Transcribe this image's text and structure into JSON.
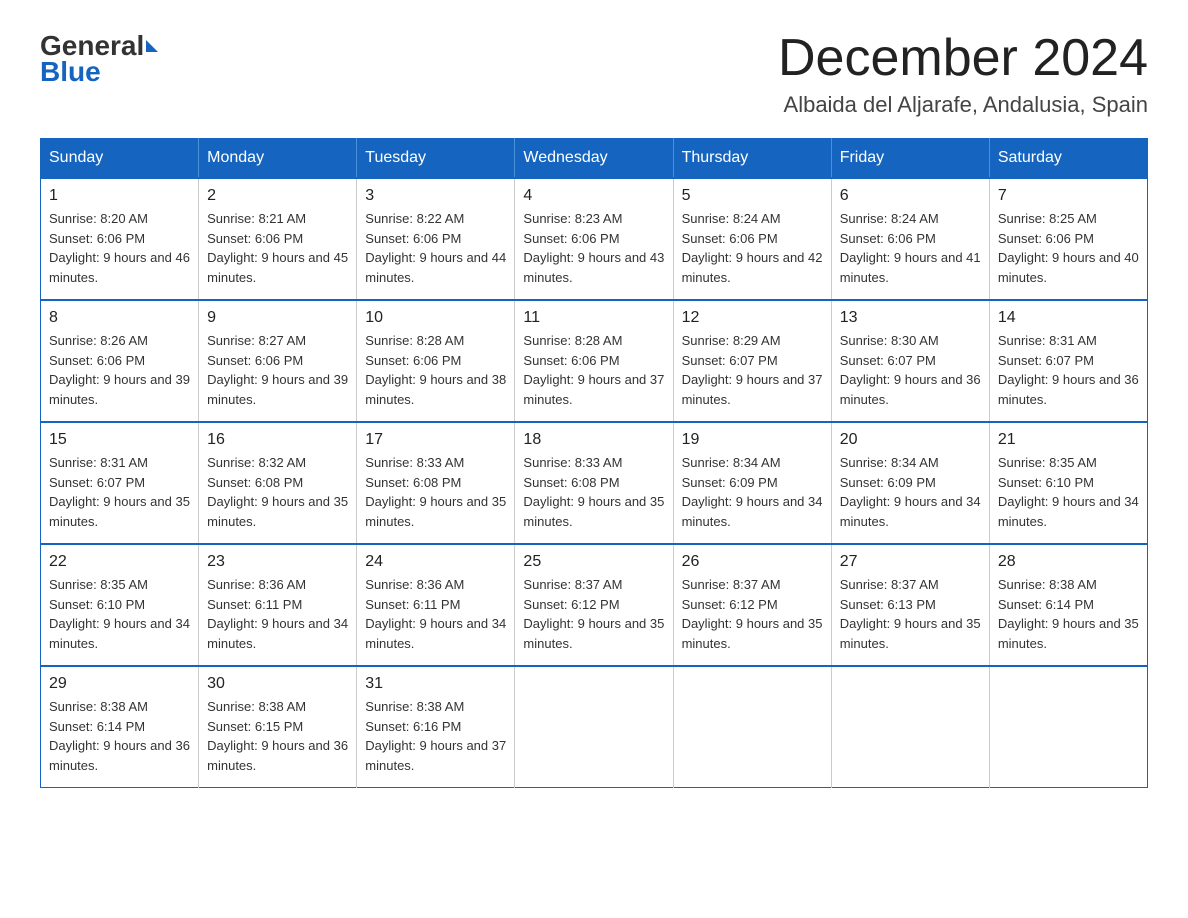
{
  "header": {
    "logo_general": "General",
    "logo_blue": "Blue",
    "month_title": "December 2024",
    "location": "Albaida del Aljarafe, Andalusia, Spain"
  },
  "weekdays": [
    "Sunday",
    "Monday",
    "Tuesday",
    "Wednesday",
    "Thursday",
    "Friday",
    "Saturday"
  ],
  "weeks": [
    [
      {
        "day": "1",
        "sunrise": "8:20 AM",
        "sunset": "6:06 PM",
        "daylight": "9 hours and 46 minutes."
      },
      {
        "day": "2",
        "sunrise": "8:21 AM",
        "sunset": "6:06 PM",
        "daylight": "9 hours and 45 minutes."
      },
      {
        "day": "3",
        "sunrise": "8:22 AM",
        "sunset": "6:06 PM",
        "daylight": "9 hours and 44 minutes."
      },
      {
        "day": "4",
        "sunrise": "8:23 AM",
        "sunset": "6:06 PM",
        "daylight": "9 hours and 43 minutes."
      },
      {
        "day": "5",
        "sunrise": "8:24 AM",
        "sunset": "6:06 PM",
        "daylight": "9 hours and 42 minutes."
      },
      {
        "day": "6",
        "sunrise": "8:24 AM",
        "sunset": "6:06 PM",
        "daylight": "9 hours and 41 minutes."
      },
      {
        "day": "7",
        "sunrise": "8:25 AM",
        "sunset": "6:06 PM",
        "daylight": "9 hours and 40 minutes."
      }
    ],
    [
      {
        "day": "8",
        "sunrise": "8:26 AM",
        "sunset": "6:06 PM",
        "daylight": "9 hours and 39 minutes."
      },
      {
        "day": "9",
        "sunrise": "8:27 AM",
        "sunset": "6:06 PM",
        "daylight": "9 hours and 39 minutes."
      },
      {
        "day": "10",
        "sunrise": "8:28 AM",
        "sunset": "6:06 PM",
        "daylight": "9 hours and 38 minutes."
      },
      {
        "day": "11",
        "sunrise": "8:28 AM",
        "sunset": "6:06 PM",
        "daylight": "9 hours and 37 minutes."
      },
      {
        "day": "12",
        "sunrise": "8:29 AM",
        "sunset": "6:07 PM",
        "daylight": "9 hours and 37 minutes."
      },
      {
        "day": "13",
        "sunrise": "8:30 AM",
        "sunset": "6:07 PM",
        "daylight": "9 hours and 36 minutes."
      },
      {
        "day": "14",
        "sunrise": "8:31 AM",
        "sunset": "6:07 PM",
        "daylight": "9 hours and 36 minutes."
      }
    ],
    [
      {
        "day": "15",
        "sunrise": "8:31 AM",
        "sunset": "6:07 PM",
        "daylight": "9 hours and 35 minutes."
      },
      {
        "day": "16",
        "sunrise": "8:32 AM",
        "sunset": "6:08 PM",
        "daylight": "9 hours and 35 minutes."
      },
      {
        "day": "17",
        "sunrise": "8:33 AM",
        "sunset": "6:08 PM",
        "daylight": "9 hours and 35 minutes."
      },
      {
        "day": "18",
        "sunrise": "8:33 AM",
        "sunset": "6:08 PM",
        "daylight": "9 hours and 35 minutes."
      },
      {
        "day": "19",
        "sunrise": "8:34 AM",
        "sunset": "6:09 PM",
        "daylight": "9 hours and 34 minutes."
      },
      {
        "day": "20",
        "sunrise": "8:34 AM",
        "sunset": "6:09 PM",
        "daylight": "9 hours and 34 minutes."
      },
      {
        "day": "21",
        "sunrise": "8:35 AM",
        "sunset": "6:10 PM",
        "daylight": "9 hours and 34 minutes."
      }
    ],
    [
      {
        "day": "22",
        "sunrise": "8:35 AM",
        "sunset": "6:10 PM",
        "daylight": "9 hours and 34 minutes."
      },
      {
        "day": "23",
        "sunrise": "8:36 AM",
        "sunset": "6:11 PM",
        "daylight": "9 hours and 34 minutes."
      },
      {
        "day": "24",
        "sunrise": "8:36 AM",
        "sunset": "6:11 PM",
        "daylight": "9 hours and 34 minutes."
      },
      {
        "day": "25",
        "sunrise": "8:37 AM",
        "sunset": "6:12 PM",
        "daylight": "9 hours and 35 minutes."
      },
      {
        "day": "26",
        "sunrise": "8:37 AM",
        "sunset": "6:12 PM",
        "daylight": "9 hours and 35 minutes."
      },
      {
        "day": "27",
        "sunrise": "8:37 AM",
        "sunset": "6:13 PM",
        "daylight": "9 hours and 35 minutes."
      },
      {
        "day": "28",
        "sunrise": "8:38 AM",
        "sunset": "6:14 PM",
        "daylight": "9 hours and 35 minutes."
      }
    ],
    [
      {
        "day": "29",
        "sunrise": "8:38 AM",
        "sunset": "6:14 PM",
        "daylight": "9 hours and 36 minutes."
      },
      {
        "day": "30",
        "sunrise": "8:38 AM",
        "sunset": "6:15 PM",
        "daylight": "9 hours and 36 minutes."
      },
      {
        "day": "31",
        "sunrise": "8:38 AM",
        "sunset": "6:16 PM",
        "daylight": "9 hours and 37 minutes."
      },
      null,
      null,
      null,
      null
    ]
  ]
}
